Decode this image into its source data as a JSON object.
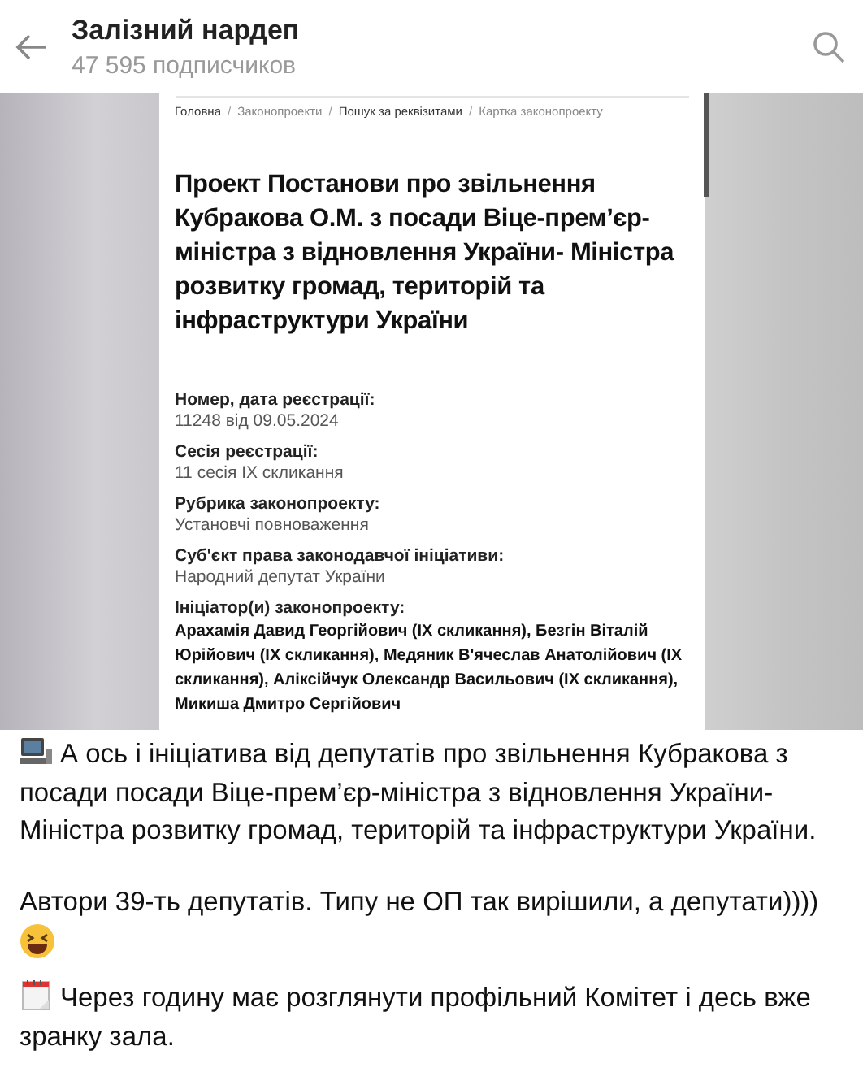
{
  "header": {
    "title": "Залізний нардеп",
    "subtitle": "47 595 подписчиков"
  },
  "document": {
    "breadcrumbs": [
      {
        "label": "Головна",
        "highlighted": true
      },
      {
        "separator": "/",
        "label": "Законопроекти",
        "highlighted": false
      },
      {
        "separator": "/",
        "label": "Пошук за реквізитами",
        "highlighted": true
      },
      {
        "separator": "/",
        "label": "Картка законопроекту",
        "highlighted": false
      }
    ],
    "title": "Проект Постанови про звільнення Кубракова О.М. з посади Віце-прем’єр-міністра з відновлення України- Міністра розвитку громад, територій та інфраструктури України",
    "fields": [
      {
        "label": "Номер, дата реєстрації:",
        "value": "11248 від 09.05.2024",
        "kind": "plain"
      },
      {
        "label": "Сесія реєстрації:",
        "value": "11 сесія IX скликання",
        "kind": "plain"
      },
      {
        "label": "Рубрика законопроекту:",
        "value": "Установчі повноваження",
        "kind": "plain"
      },
      {
        "label": "Суб'єкт права законодавчої ініціативи:",
        "value": "Народний депутат України",
        "kind": "plain"
      },
      {
        "label": "Ініціатор(и) законопроекту:",
        "value": "Арахамія Давид Георгійович (IX скликання), Безгін Віталій Юрійович (IX скликання), Медяник В'ячеслав Анатолійович (IX скликання), Аліксійчук Олександр Васильович (IX скликання), Микиша Дмитро Сергійович",
        "kind": "strong"
      }
    ]
  },
  "message": {
    "paragraphs": [
      {
        "kind": "computer",
        "text": "А ось і ініціатива від депутатів про звільнення Кубракова з посади посади Віце-прем’єр-міністра з відновлення України-Міністра розвитку громад, територій та інфраструктури  України."
      },
      {
        "kind": "plain",
        "text": "Автори 39-ть депутатів. Типу не ОП так вирішили, а депутати))))"
      },
      {
        "kind": "laugh"
      },
      {
        "kind": "calendar",
        "text": "Через годину має розглянути профільний Комітет і десь вже зранку зала."
      }
    ]
  }
}
